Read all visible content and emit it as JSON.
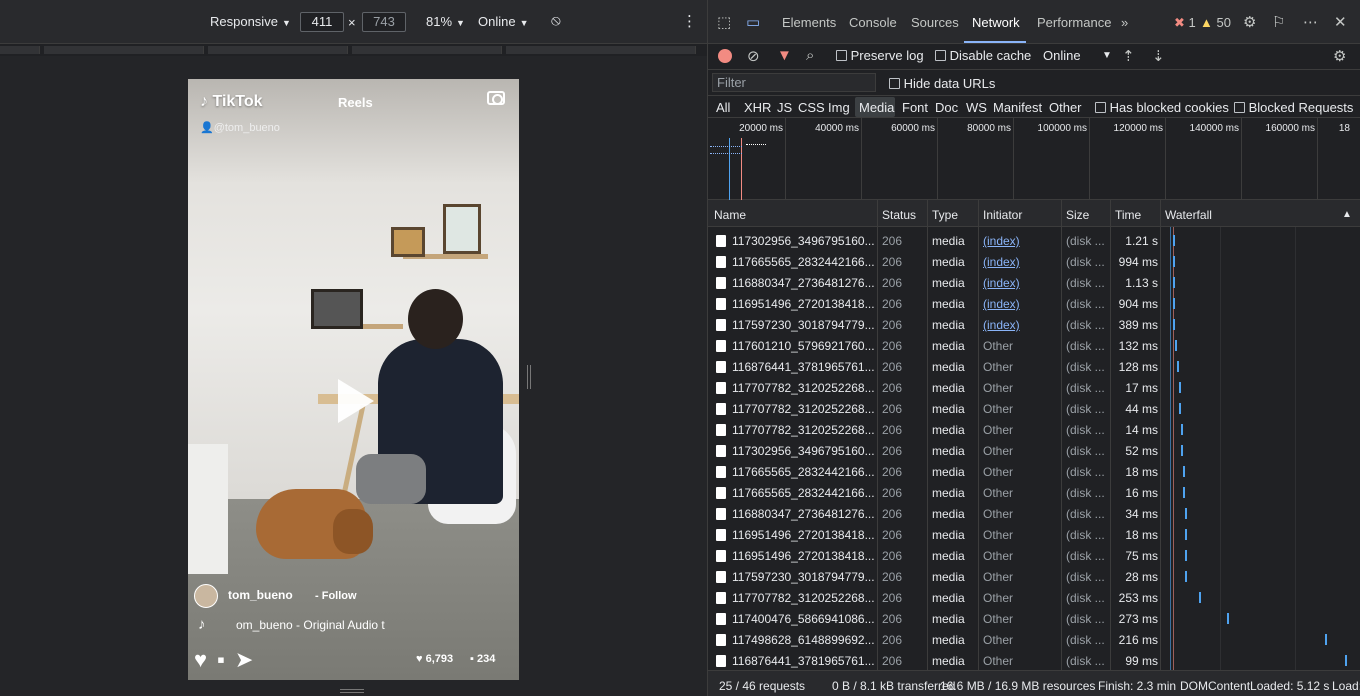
{
  "device_toolbar": {
    "device": "Responsive",
    "width": "411",
    "separator": "×",
    "height": "743",
    "zoom": "81%",
    "throttle": "Online"
  },
  "tiktok": {
    "logo": "TikTok",
    "reels": "Reels",
    "handle": "@tom_bueno",
    "username": "tom_bueno",
    "follow": "- Follow",
    "music_note": "♪",
    "audio": "om_bueno - Original Audio  t",
    "likes": "♥ 6,793",
    "comments": "▪ 234"
  },
  "devtools": {
    "tabs": [
      "Elements",
      "Console",
      "Sources",
      "Network",
      "Performance"
    ],
    "more_tabs": "»",
    "errors": "1",
    "warnings": "50",
    "toolbar": {
      "preserve_log": "Preserve log",
      "disable_cache": "Disable cache",
      "throttle": "Online"
    },
    "filter_placeholder": "Filter",
    "hide_data_urls": "Hide data URLs",
    "type_filters": [
      "All",
      "XHR",
      "JS",
      "CSS",
      "Img",
      "Media",
      "Font",
      "Doc",
      "WS",
      "Manifest",
      "Other"
    ],
    "has_blocked_cookies": "Has blocked cookies",
    "blocked_requests": "Blocked Requests",
    "overview_ticks": [
      "20000 ms",
      "40000 ms",
      "60000 ms",
      "80000 ms",
      "100000 ms",
      "120000 ms",
      "140000 ms",
      "160000 ms",
      "18"
    ],
    "columns": [
      "Name",
      "Status",
      "Type",
      "Initiator",
      "Size",
      "Time",
      "Waterfall"
    ],
    "rows": [
      {
        "name": "117302956_3496795160...",
        "status": "206",
        "type": "media",
        "initiator": "(index)",
        "size": "(disk ...",
        "time": "1.21 s",
        "wf": 0.04
      },
      {
        "name": "117665565_2832442166...",
        "status": "206",
        "type": "media",
        "initiator": "(index)",
        "size": "(disk ...",
        "time": "994 ms",
        "wf": 0.04
      },
      {
        "name": "116880347_2736481276...",
        "status": "206",
        "type": "media",
        "initiator": "(index)",
        "size": "(disk ...",
        "time": "1.13 s",
        "wf": 0.04
      },
      {
        "name": "116951496_2720138418...",
        "status": "206",
        "type": "media",
        "initiator": "(index)",
        "size": "(disk ...",
        "time": "904 ms",
        "wf": 0.04
      },
      {
        "name": "117597230_3018794779...",
        "status": "206",
        "type": "media",
        "initiator": "(index)",
        "size": "(disk ...",
        "time": "389 ms",
        "wf": 0.04
      },
      {
        "name": "117601210_5796921760...",
        "status": "206",
        "type": "media",
        "initiator": "Other",
        "size": "(disk ...",
        "time": "132 ms",
        "wf": 0.05
      },
      {
        "name": "116876441_3781965761...",
        "status": "206",
        "type": "media",
        "initiator": "Other",
        "size": "(disk ...",
        "time": "128 ms",
        "wf": 0.06
      },
      {
        "name": "117707782_3120252268...",
        "status": "206",
        "type": "media",
        "initiator": "Other",
        "size": "(disk ...",
        "time": "17 ms",
        "wf": 0.07
      },
      {
        "name": "117707782_3120252268...",
        "status": "206",
        "type": "media",
        "initiator": "Other",
        "size": "(disk ...",
        "time": "44 ms",
        "wf": 0.07
      },
      {
        "name": "117707782_3120252268...",
        "status": "206",
        "type": "media",
        "initiator": "Other",
        "size": "(disk ...",
        "time": "14 ms",
        "wf": 0.08
      },
      {
        "name": "117302956_3496795160...",
        "status": "206",
        "type": "media",
        "initiator": "Other",
        "size": "(disk ...",
        "time": "52 ms",
        "wf": 0.08
      },
      {
        "name": "117665565_2832442166...",
        "status": "206",
        "type": "media",
        "initiator": "Other",
        "size": "(disk ...",
        "time": "18 ms",
        "wf": 0.09
      },
      {
        "name": "117665565_2832442166...",
        "status": "206",
        "type": "media",
        "initiator": "Other",
        "size": "(disk ...",
        "time": "16 ms",
        "wf": 0.09
      },
      {
        "name": "116880347_2736481276...",
        "status": "206",
        "type": "media",
        "initiator": "Other",
        "size": "(disk ...",
        "time": "34 ms",
        "wf": 0.1
      },
      {
        "name": "116951496_2720138418...",
        "status": "206",
        "type": "media",
        "initiator": "Other",
        "size": "(disk ...",
        "time": "18 ms",
        "wf": 0.1
      },
      {
        "name": "116951496_2720138418...",
        "status": "206",
        "type": "media",
        "initiator": "Other",
        "size": "(disk ...",
        "time": "75 ms",
        "wf": 0.1
      },
      {
        "name": "117597230_3018794779...",
        "status": "206",
        "type": "media",
        "initiator": "Other",
        "size": "(disk ...",
        "time": "28 ms",
        "wf": 0.1
      },
      {
        "name": "117707782_3120252268...",
        "status": "206",
        "type": "media",
        "initiator": "Other",
        "size": "(disk ...",
        "time": "253 ms",
        "wf": 0.18
      },
      {
        "name": "117400476_5866941086...",
        "status": "206",
        "type": "media",
        "initiator": "Other",
        "size": "(disk ...",
        "time": "273 ms",
        "wf": 0.33
      },
      {
        "name": "117498628_6148899692...",
        "status": "206",
        "type": "media",
        "initiator": "Other",
        "size": "(disk ...",
        "time": "216 ms",
        "wf": 0.86
      },
      {
        "name": "116876441_3781965761...",
        "status": "206",
        "type": "media",
        "initiator": "Other",
        "size": "(disk ...",
        "time": "99 ms",
        "wf": 0.97
      }
    ],
    "footer": {
      "requests": "25 / 46 requests",
      "transferred": "0 B / 8.1 kB transferred",
      "resources": "16.6 MB / 16.9 MB resources",
      "finish": "Finish: 2.3 min",
      "dcl": "DOMContentLoaded: 5.12 s",
      "load": "Load:"
    }
  }
}
